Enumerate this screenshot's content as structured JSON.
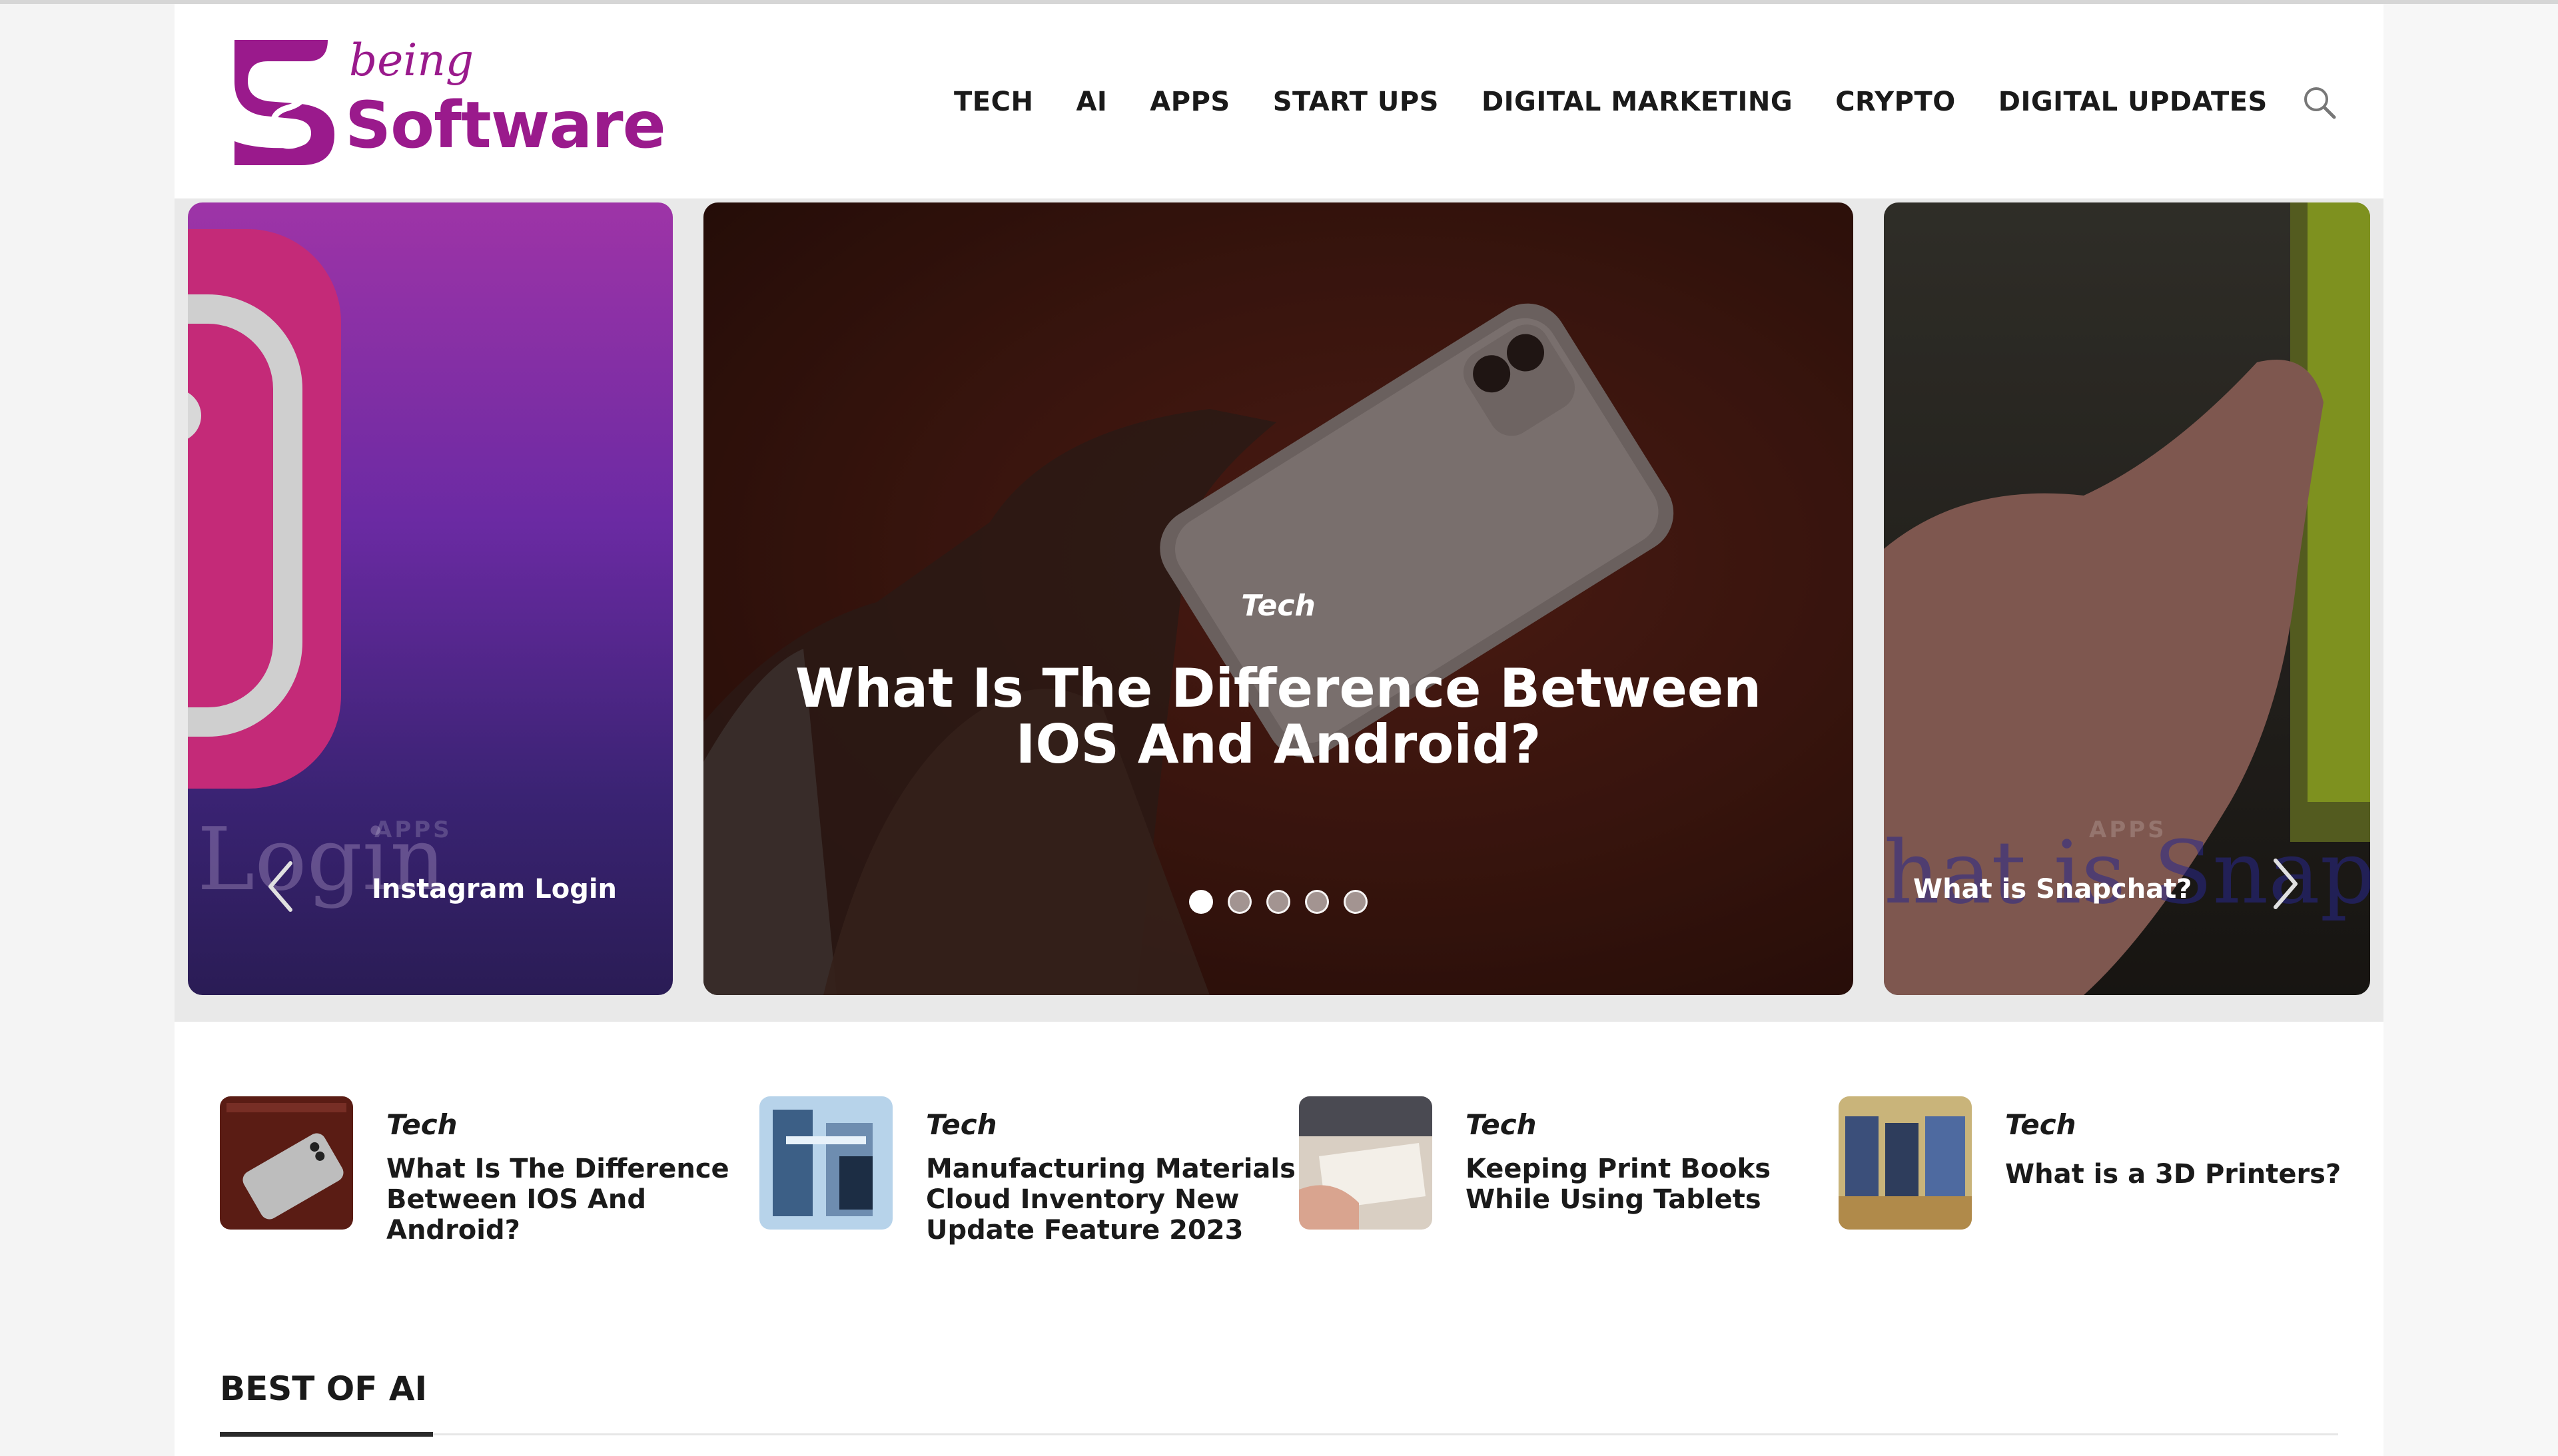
{
  "brand": {
    "logo_being": "being",
    "logo_software": "Software",
    "accent_color": "#9a1a8c"
  },
  "nav": {
    "items": [
      {
        "label": "TECH"
      },
      {
        "label": "AI"
      },
      {
        "label": "APPS"
      },
      {
        "label": "START UPS"
      },
      {
        "label": "DIGITAL MARKETING"
      },
      {
        "label": "CRYPTO"
      },
      {
        "label": "DIGITAL UPDATES"
      }
    ],
    "search_icon": "search-icon"
  },
  "slider": {
    "left": {
      "category": "APPS",
      "title": "Instagram Login",
      "bg_text": "Login"
    },
    "center": {
      "category": "Tech",
      "title": "What Is The Difference Between IOS And Android?"
    },
    "right": {
      "category": "APPS",
      "title": "What is Snapchat?",
      "bg_text": "hat is Snap"
    },
    "prev_icon": "chevron-left-icon",
    "next_icon": "chevron-right-icon",
    "dots": 5,
    "active_dot": 1
  },
  "posts": [
    {
      "category": "Tech",
      "title": "What Is The Difference Between IOS And Android?"
    },
    {
      "category": "Tech",
      "title": "Manufacturing Materials Cloud Inventory New Update Feature 2023"
    },
    {
      "category": "Tech",
      "title": "Keeping Print Books While Using Tablets"
    },
    {
      "category": "Tech",
      "title": "What is a 3D Printers?"
    }
  ],
  "section": {
    "title": "BEST OF AI"
  }
}
